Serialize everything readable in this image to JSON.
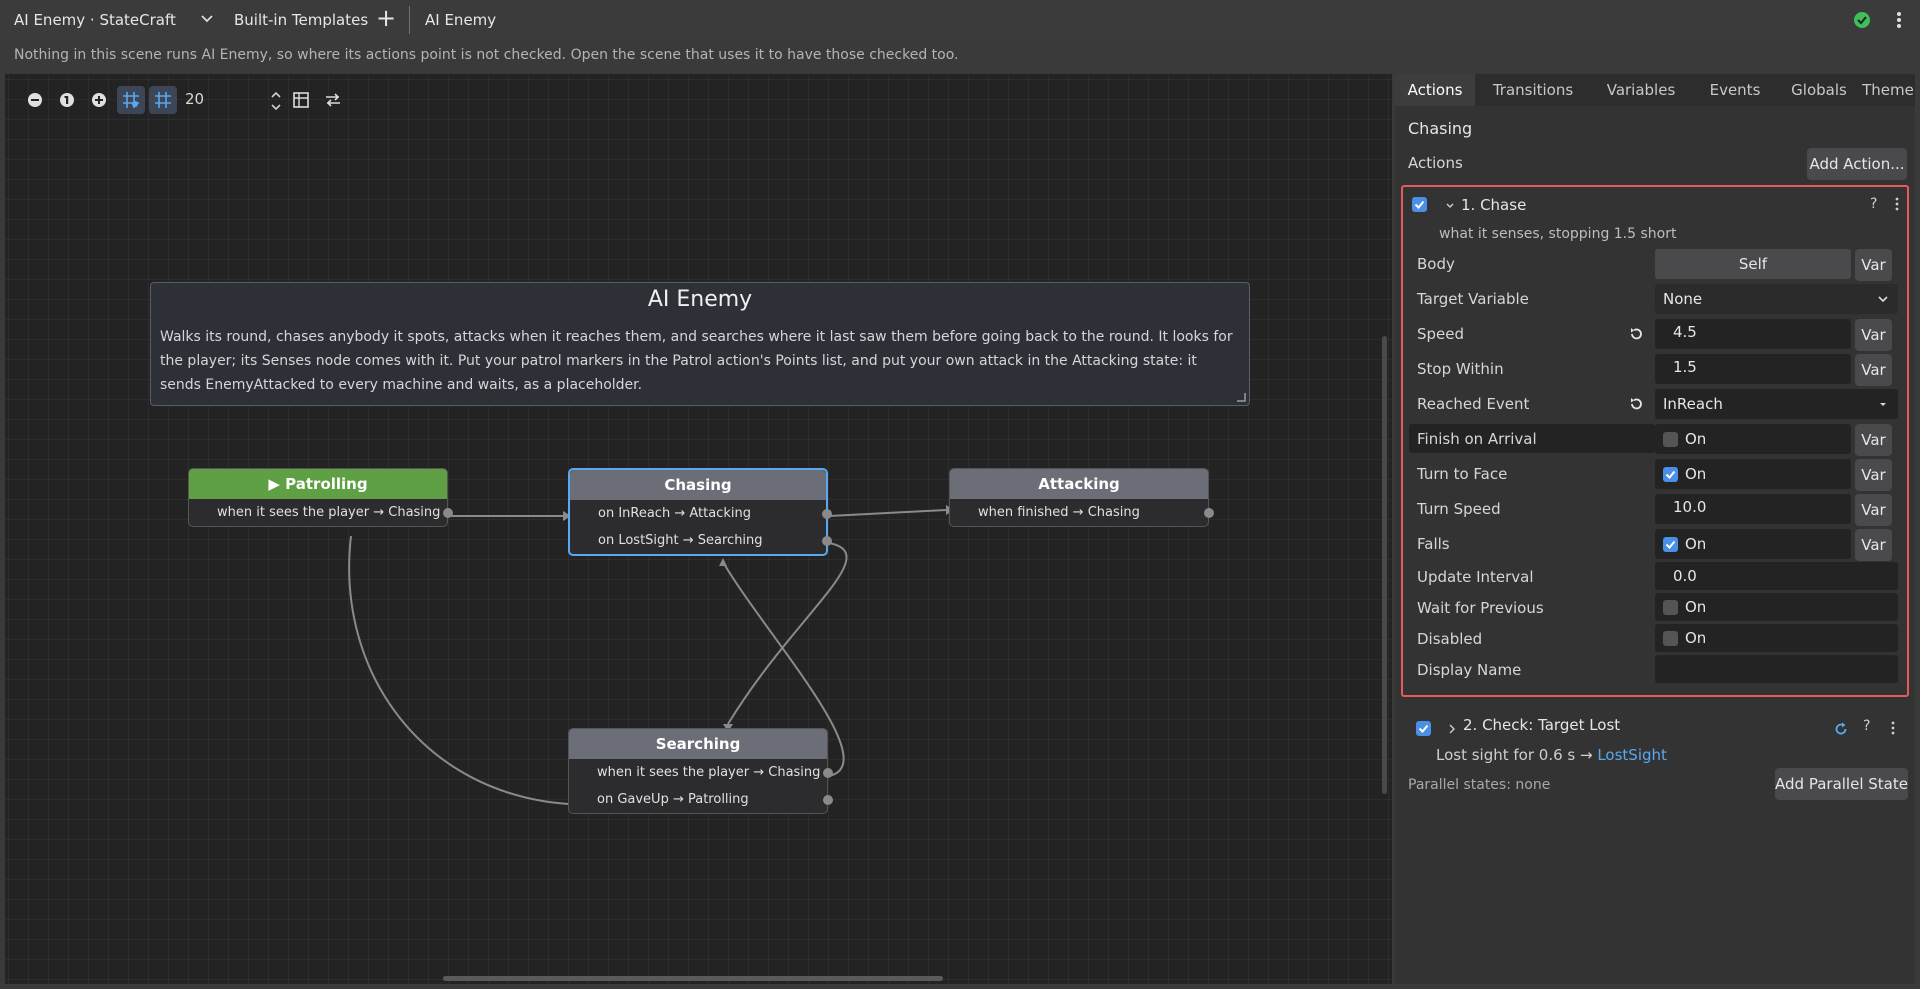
{
  "topbar": {
    "title": "AI Enemy · StateCraft",
    "templates": "Built-in Templates",
    "add": "+",
    "tab": "AI Enemy"
  },
  "notice": "Nothing in this scene runs AI Enemy, so where its actions point is not checked. Open the scene that uses it to have those checked too.",
  "canvas": {
    "zoom_value": "20",
    "comment": {
      "title": "AI Enemy",
      "body": "Walks its round, chases anybody it spots, attacks when it reaches them, and searches where it last saw them before going back to the round. It looks for the player; its Senses node comes with it. Put your patrol markers in the Patrol action's Points list, and put your own attack in the Attacking state: it sends EnemyAttacked to every machine and waits, as a placeholder."
    },
    "nodes": {
      "patrolling": {
        "title": "▶ Patrolling",
        "rows": [
          "when it sees the player  →  Chasing"
        ]
      },
      "chasing": {
        "title": "Chasing",
        "rows": [
          "on InReach  →  Attacking",
          "on LostSight  →  Searching"
        ]
      },
      "attacking": {
        "title": "Attacking",
        "rows": [
          "when finished  →  Chasing"
        ]
      },
      "searching": {
        "title": "Searching",
        "rows": [
          "when it sees the player  →  Chasing",
          "on GaveUp  →  Patrolling"
        ]
      }
    }
  },
  "panel": {
    "tabs": [
      "Actions",
      "Transitions",
      "Variables",
      "Events",
      "Globals",
      "Theme"
    ],
    "state_name": "Chasing",
    "actions_label": "Actions",
    "add_action": "Add Action...",
    "action1": {
      "title": "1. Chase",
      "help": "?",
      "description": "what it senses, stopping 1.5 short",
      "props": {
        "body": {
          "label": "Body",
          "value": "Self"
        },
        "target_variable": {
          "label": "Target Variable",
          "value": "None"
        },
        "speed": {
          "label": "Speed",
          "value": "4.5"
        },
        "stop_within": {
          "label": "Stop Within",
          "value": "1.5"
        },
        "reached_event": {
          "label": "Reached Event",
          "value": "InReach"
        },
        "finish_on_arrival": {
          "label": "Finish on Arrival",
          "value": "On",
          "checked": false
        },
        "turn_to_face": {
          "label": "Turn to Face",
          "value": "On",
          "checked": true
        },
        "turn_speed": {
          "label": "Turn Speed",
          "value": "10.0"
        },
        "falls": {
          "label": "Falls",
          "value": "On",
          "checked": true
        },
        "update_interval": {
          "label": "Update Interval",
          "value": "0.0"
        },
        "wait_for_previous": {
          "label": "Wait for Previous",
          "value": "On",
          "checked": false
        },
        "disabled": {
          "label": "Disabled",
          "value": "On",
          "checked": false
        },
        "display_name": {
          "label": "Display Name",
          "value": ""
        }
      },
      "var_label": "Var"
    },
    "action2": {
      "title": "2. Check: Target Lost",
      "help": "?",
      "description_prefix": "Lost sight for 0.6 s → ",
      "description_link": "LostSight"
    },
    "parallel": "Parallel states: none",
    "add_parallel": "Add Parallel State"
  },
  "colors": {
    "accent": "#5aa8f0",
    "start_node": "#5fa044",
    "focus_outline": "#e85a5a",
    "status_ok": "#3fbf5a"
  },
  "icons": [
    "chevron-down-icon",
    "plus-icon",
    "check-circle-icon",
    "kebab-icon",
    "zoom-out-icon",
    "zoom-reset-icon",
    "zoom-in-icon",
    "snap-grid-icon",
    "show-grid-icon",
    "minimap-icon",
    "arrange-icon",
    "reset-icon",
    "help-icon",
    "refresh-icon"
  ]
}
